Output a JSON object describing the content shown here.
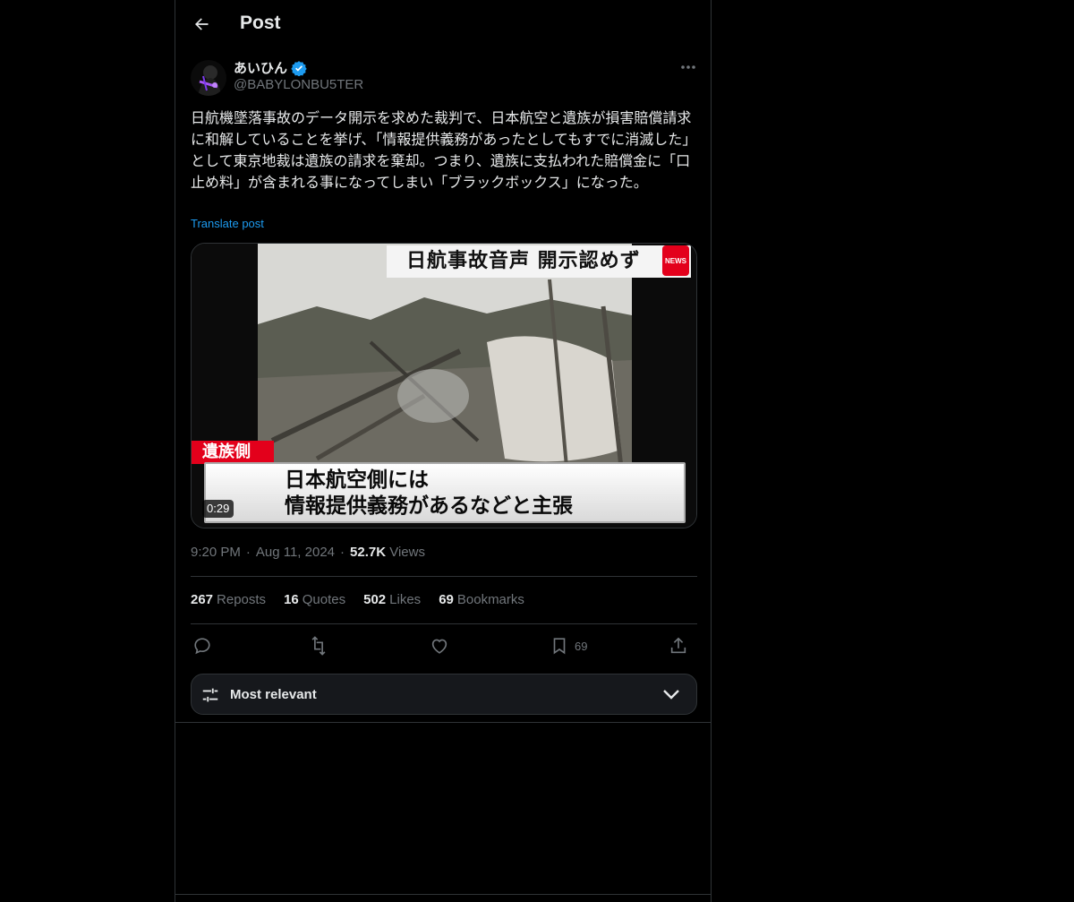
{
  "header": {
    "title": "Post"
  },
  "author": {
    "display_name": "あいひん",
    "handle": "@BABYLONBU5TER",
    "verified": true
  },
  "post": {
    "text": "日航機墜落事故のデータ開示を求めた裁判で、日本航空と遺族が損害賠償請求に和解していることを挙げ、「情報提供義務があったとしてもすでに消滅した」として東京地裁は遺族の請求を棄却。つまり、遺族に支払われた賠償金に「口止め料」が含まれる事になってしまい「ブラックボックス」になった。",
    "translate_label": "Translate post"
  },
  "media": {
    "headline": "日航事故音声 開示認めず",
    "news_badge": "NEWS",
    "side_tag": "遺族側",
    "caption_line1": "日本航空側には",
    "caption_line2": "情報提供義務があるなどと主張",
    "duration": "0:29"
  },
  "meta": {
    "time": "9:20 PM",
    "date": "Aug 11, 2024",
    "views_count": "52.7K",
    "views_label": "Views",
    "separator": "·"
  },
  "stats": {
    "reposts_count": "267",
    "reposts_label": "Reposts",
    "quotes_count": "16",
    "quotes_label": "Quotes",
    "likes_count": "502",
    "likes_label": "Likes",
    "bookmarks_count": "69",
    "bookmarks_label": "Bookmarks"
  },
  "actions": {
    "icons": [
      "reply-icon",
      "repost-icon",
      "like-icon",
      "bookmark-icon",
      "share-icon"
    ],
    "bookmark_count": "69"
  },
  "sort": {
    "label": "Most relevant"
  },
  "colors": {
    "background": "#000000",
    "text": "#e7e9ea",
    "muted": "#71767b",
    "link": "#1d9bf0",
    "verified": "#1d9bf0",
    "border": "#2f3336",
    "news_red": "#e3001b"
  }
}
